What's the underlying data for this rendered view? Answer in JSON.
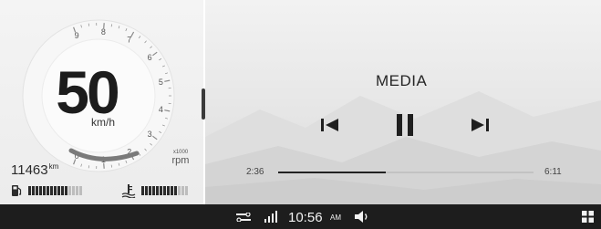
{
  "cluster": {
    "speed": "50",
    "speed_unit": "km/h",
    "odometer": "11463",
    "odometer_unit": "km",
    "rpm_multiplier": "x1000",
    "rpm_unit": "rpm",
    "tach_labels": [
      "0",
      "1",
      "2",
      "3",
      "4",
      "5",
      "6",
      "7",
      "8",
      "9"
    ],
    "fuel_level": 0.7,
    "temp_level": 0.8,
    "fuel_icon": "fuel-pump-icon",
    "temp_icon": "coolant-temperature-icon"
  },
  "media": {
    "title": "MEDIA",
    "elapsed": "2:36",
    "duration": "6:11",
    "progress": 0.42,
    "controls": [
      "previous-track-icon",
      "pause-icon",
      "next-track-icon"
    ]
  },
  "statusbar": {
    "time": "10:56",
    "ampm": "AM",
    "icons": [
      "connection-icon",
      "signal-icon",
      "volume-icon",
      "apps-grid-icon"
    ]
  },
  "colors": {
    "status_bg": "#1d1d1d",
    "status_fg": "#f2f2f2",
    "gauge_arc": "#7a7a7a",
    "text_dark": "#1c1c1c",
    "bar_filled": "#2b2b2b",
    "bar_empty": "#bdbdbd"
  }
}
